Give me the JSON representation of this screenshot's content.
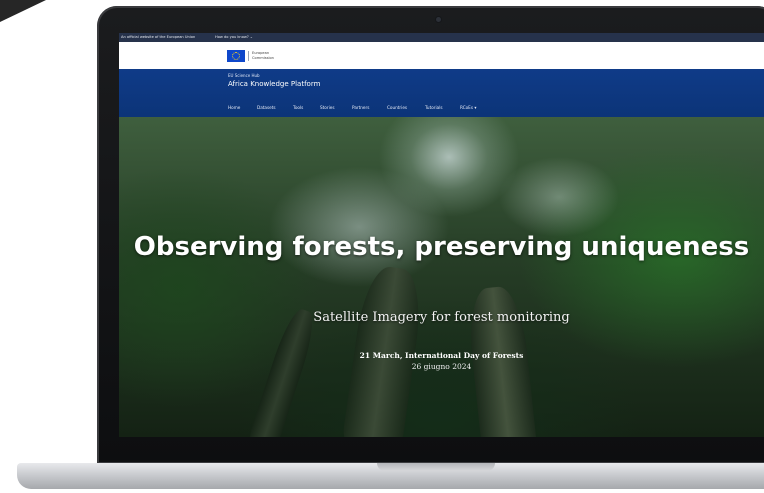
{
  "top_bar": {
    "official_text": "An official website of the European Union",
    "how_know": "How do you know?"
  },
  "ec_logo": {
    "text": "European\nCommission"
  },
  "header": {
    "hub_label": "EU Science Hub",
    "site_title": "Africa Knowledge Platform"
  },
  "nav": {
    "items": [
      {
        "label": "Home"
      },
      {
        "label": "Datasets"
      },
      {
        "label": "Tools"
      },
      {
        "label": "Stories"
      },
      {
        "label": "Partners"
      },
      {
        "label": "Countries"
      },
      {
        "label": "Tutorials"
      },
      {
        "label": "RCoEs"
      }
    ],
    "dropdown_caret": "▾"
  },
  "hero": {
    "title": "Observing forests, preserving uniqueness",
    "subtitle": "Satellite Imagery for forest monitoring",
    "event": "21 March, International Day of Forests",
    "date": "26 giugno 2024"
  },
  "colors": {
    "eu_blue_bar": "#26324b",
    "header_blue": "#0f3b88",
    "flag_blue": "#0e47cb",
    "flag_yellow": "#ffd617"
  }
}
